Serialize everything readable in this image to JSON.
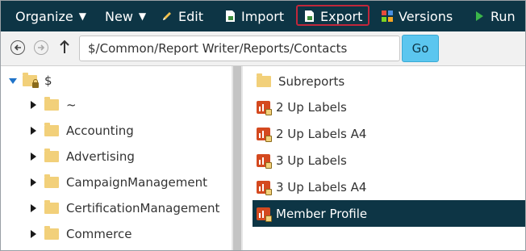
{
  "toolbar": {
    "organize": "Organize",
    "new": "New",
    "edit": "Edit",
    "import": "Import",
    "export": "Export",
    "versions": "Versions",
    "run": "Run",
    "highlight_color": "#c0273b",
    "bg_color": "#0d3545"
  },
  "address": {
    "path": "$/Common/Report Writer/Reports/Contacts",
    "go": "Go"
  },
  "tree": {
    "root": "$",
    "items": [
      "~",
      "Accounting",
      "Advertising",
      "CampaignManagement",
      "CertificationManagement",
      "Commerce"
    ]
  },
  "list": {
    "items": [
      {
        "label": "Subreports",
        "icon": "folder-icon"
      },
      {
        "label": "2 Up Labels",
        "icon": "report-icon"
      },
      {
        "label": "2 Up Labels A4",
        "icon": "report-icon"
      },
      {
        "label": "3 Up Labels",
        "icon": "report-icon"
      },
      {
        "label": "3 Up Labels A4",
        "icon": "report-icon"
      },
      {
        "label": "Member Profile",
        "icon": "report-icon",
        "selected": true
      }
    ]
  }
}
